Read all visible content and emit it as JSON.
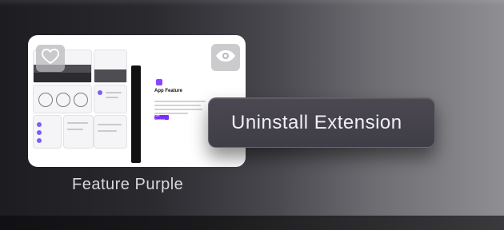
{
  "card": {
    "label": "Feature  Purple",
    "preview_title": "App Feature",
    "preview_button_label": "Get Started"
  },
  "context_menu": {
    "item_label": "Uninstall Extension"
  },
  "icons": {
    "favorite": "heart-icon",
    "preview": "eye-icon"
  },
  "colors": {
    "accent": "#7b2cff",
    "card_bg": "#ffffff",
    "menu_bg": "#45424b"
  }
}
